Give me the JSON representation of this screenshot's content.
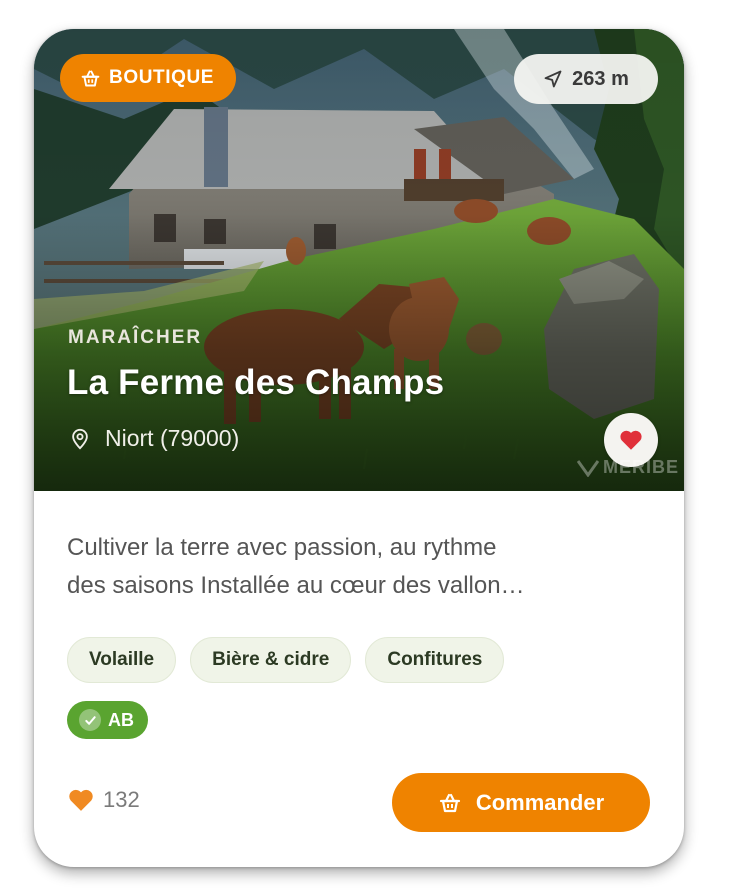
{
  "card": {
    "badge": {
      "label": "BOUTIQUE",
      "icon": "shopping-basket-icon"
    },
    "distance": {
      "value": "263 m",
      "icon": "navigation-arrow-icon"
    },
    "category": "MARAÎCHER",
    "title": "La Ferme des Champs",
    "location": {
      "text": "Niort (79000)",
      "icon": "location-pin-icon"
    },
    "favorite": {
      "icon": "heart-icon",
      "active": true
    },
    "image": {
      "alt": "Mountain farmhouse with cows grazing on a green hillside",
      "watermark": "MERIBE"
    },
    "description_lines": [
      "Cultiver la terre avec passion, au rythme",
      "des saisons  Installée au cœur des vallon…"
    ],
    "tags": [
      "Volaille",
      "Bière & cidre",
      "Confitures"
    ],
    "label": {
      "text": "AB",
      "icon": "check-icon"
    },
    "likes": {
      "count": "132",
      "icon": "heart-icon"
    },
    "order_button": {
      "label": "Commander",
      "icon": "shopping-basket-icon"
    }
  },
  "colors": {
    "accent": "#ef8300",
    "label_green": "#5aa430",
    "tag_bg": "#f0f4e8",
    "heart_red": "#e0303a",
    "heart_orange": "#f08a22"
  }
}
